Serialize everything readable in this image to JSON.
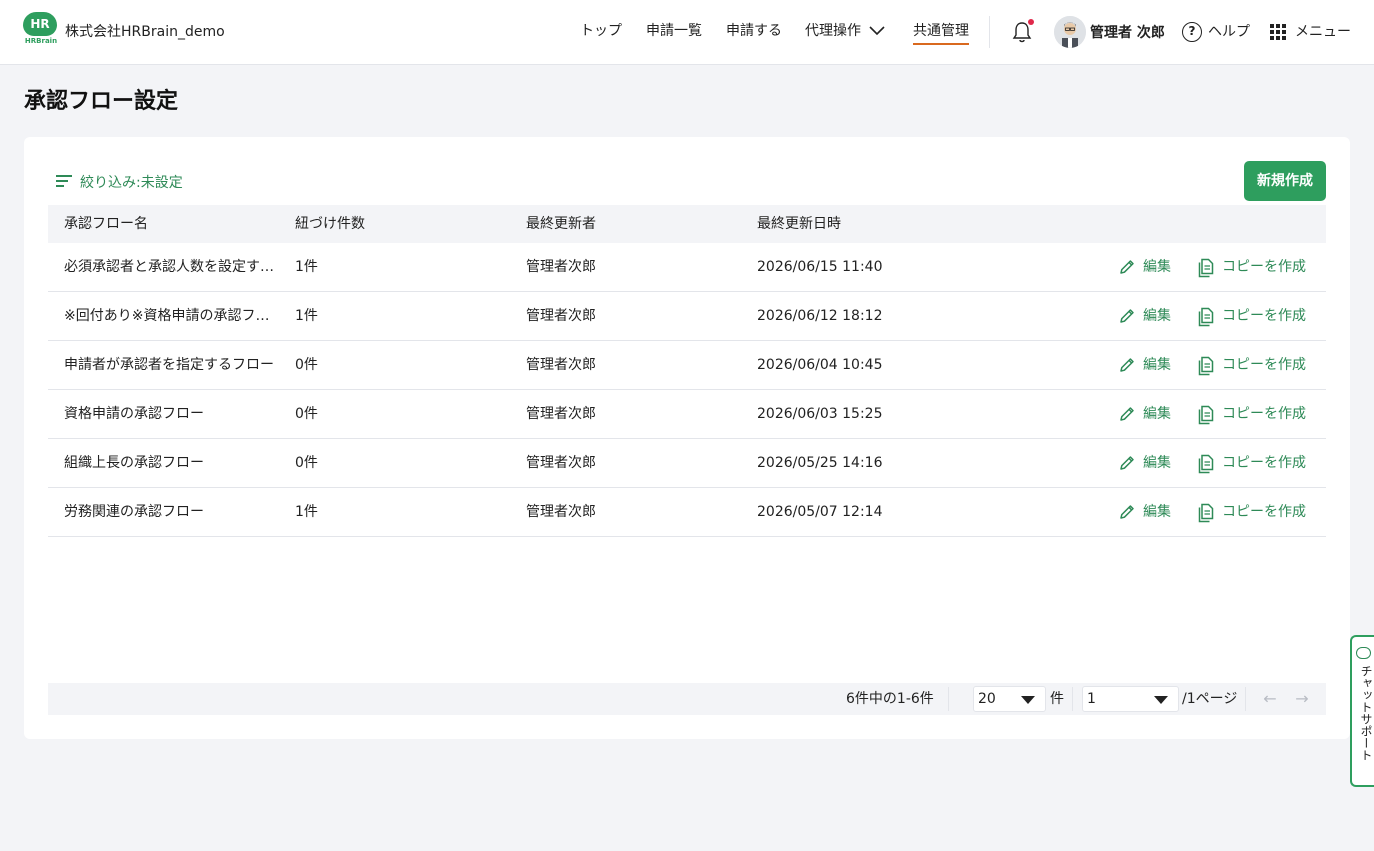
{
  "header": {
    "logo_text": "HR",
    "logo_sub": "HRBrain",
    "company": "株式会社HRBrain_demo",
    "nav": [
      {
        "label": "トップ"
      },
      {
        "label": "申請一覧"
      },
      {
        "label": "申請する"
      },
      {
        "label": "代理操作"
      },
      {
        "label": "共通管理"
      }
    ],
    "active_nav": "共通管理",
    "user_name": "管理者 次郎",
    "help_label": "ヘルプ",
    "menu_label": "メニュー"
  },
  "page": {
    "title": "承認フロー設定"
  },
  "toolbar": {
    "filter_label": "絞り込み:未設定",
    "new_button": "新規作成"
  },
  "table": {
    "columns": [
      "承認フロー名",
      "紐づけ件数",
      "最終更新者",
      "最終更新日時"
    ],
    "rows": [
      {
        "name": "必須承認者と承認人数を設定す…",
        "count": "1件",
        "updater": "管理者次郎",
        "updated": "2026/06/15 11:40",
        "edit": "編集",
        "copy": "コピーを作成"
      },
      {
        "name": "※回付あり※資格申請の承認フロー",
        "count": "1件",
        "updater": "管理者次郎",
        "updated": "2026/06/12 18:12",
        "edit": "編集",
        "copy": "コピーを作成"
      },
      {
        "name": "申請者が承認者を指定するフロー",
        "count": "0件",
        "updater": "管理者次郎",
        "updated": "2026/06/04 10:45",
        "edit": "編集",
        "copy": "コピーを作成"
      },
      {
        "name": "資格申請の承認フロー",
        "count": "0件",
        "updater": "管理者次郎",
        "updated": "2026/06/03 15:25",
        "edit": "編集",
        "copy": "コピーを作成"
      },
      {
        "name": "組織上長の承認フロー",
        "count": "0件",
        "updater": "管理者次郎",
        "updated": "2026/05/25 14:16",
        "edit": "編集",
        "copy": "コピーを作成"
      },
      {
        "name": "労務関連の承認フロー",
        "count": "1件",
        "updater": "管理者次郎",
        "updated": "2026/05/07 12:14",
        "edit": "編集",
        "copy": "コピーを作成"
      }
    ]
  },
  "pagination": {
    "summary": "6件中の1-6件",
    "per_page": "20",
    "per_page_unit": "件",
    "page": "1",
    "total_pages": "/1ページ",
    "prev_icon": "arrow-left-icon",
    "next_icon": "arrow-right-icon"
  },
  "chat_support": {
    "label": "チャットサポート"
  },
  "colors": {
    "brand_green": "#2e9e5e",
    "link_green": "#2e8a57",
    "active_underline": "#d9691f",
    "notification_dot": "#e0284a"
  }
}
